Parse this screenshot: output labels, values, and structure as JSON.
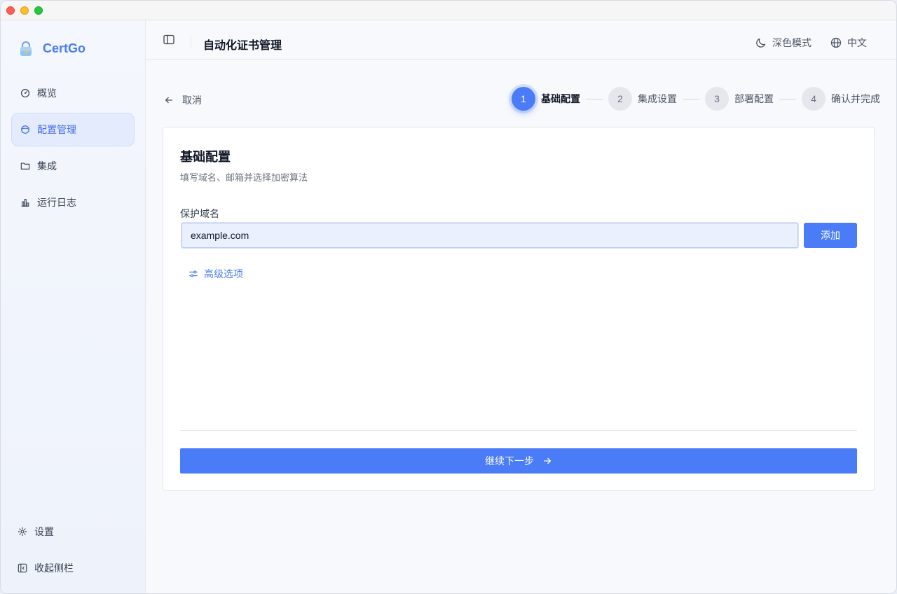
{
  "app": {
    "name": "CertGo"
  },
  "sidebar": {
    "items": [
      {
        "label": "概览",
        "icon": "gauge-icon"
      },
      {
        "label": "配置管理",
        "icon": "circle-icon",
        "active": true
      },
      {
        "label": "集成",
        "icon": "folder-icon"
      },
      {
        "label": "运行日志",
        "icon": "bar-chart-icon"
      }
    ],
    "settings_label": "设置",
    "collapse_label": "收起侧栏"
  },
  "header": {
    "title": "自动化证书管理",
    "dark_mode_label": "深色模式",
    "language_label": "中文"
  },
  "wizard": {
    "cancel_label": "取消",
    "steps": [
      {
        "num": "1",
        "label": "基础配置",
        "active": true
      },
      {
        "num": "2",
        "label": "集成设置"
      },
      {
        "num": "3",
        "label": "部署配置"
      },
      {
        "num": "4",
        "label": "确认并完成"
      }
    ]
  },
  "form": {
    "title": "基础配置",
    "subtitle": "填写域名、邮箱并选择加密算法",
    "domain_label": "保护域名",
    "domain_value": "example.com",
    "add_label": "添加",
    "advanced_label": "高级选项",
    "next_label": "继续下一步"
  },
  "colors": {
    "accent": "#4a7cf7",
    "active_bg": "#e4ebfd"
  }
}
